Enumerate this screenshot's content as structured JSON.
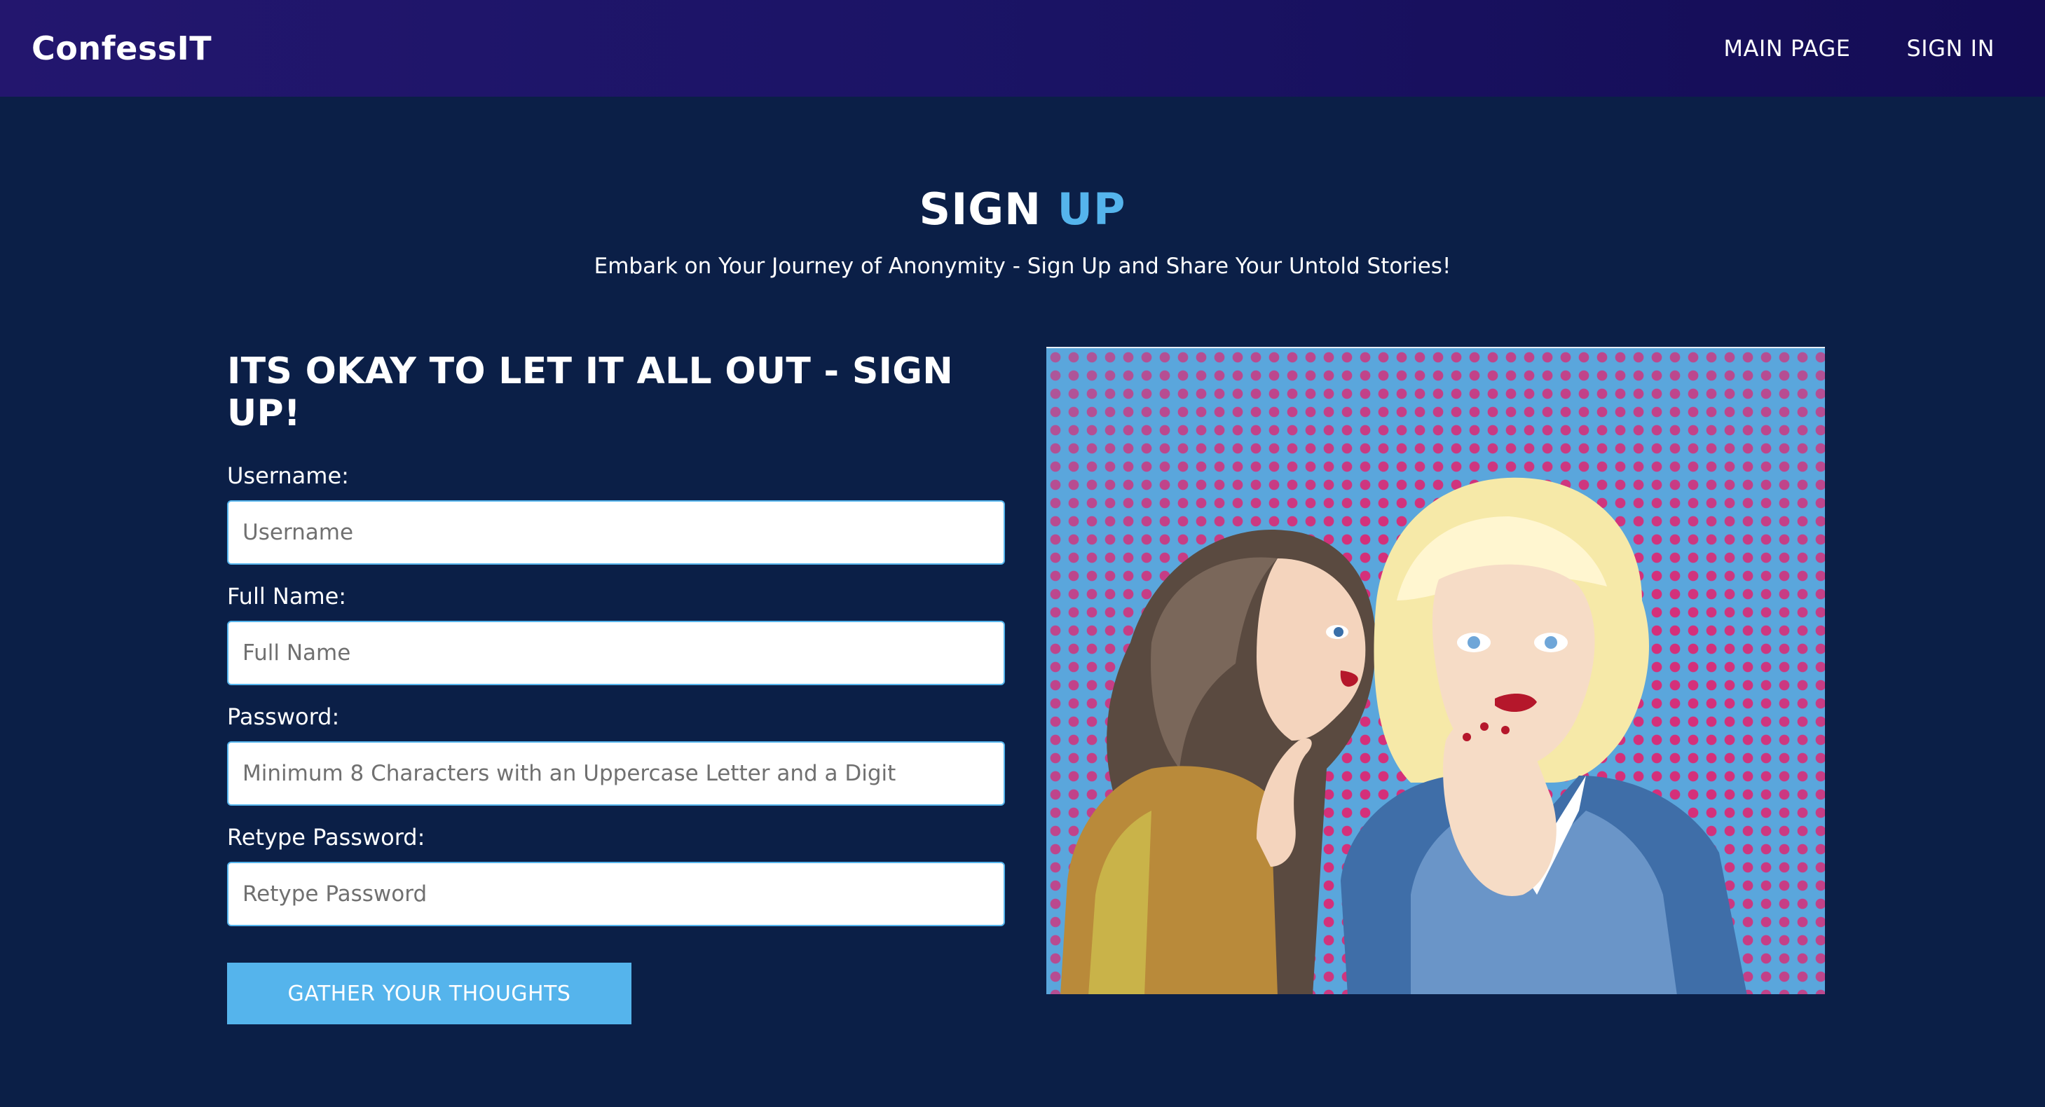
{
  "nav": {
    "brand": "ConfessIT",
    "links": [
      "MAIN PAGE",
      "SIGN IN"
    ]
  },
  "hero": {
    "title_main": "SIGN",
    "title_accent": "UP",
    "subtitle": "Embark on Your Journey of Anonymity - Sign Up and Share Your Untold Stories!"
  },
  "form": {
    "heading": "ITS OKAY TO LET IT ALL OUT - SIGN UP!",
    "fields": [
      {
        "label": "Username:",
        "placeholder": "Username",
        "value": ""
      },
      {
        "label": "Full Name:",
        "placeholder": "Full Name",
        "value": ""
      },
      {
        "label": "Password:",
        "placeholder": "Minimum 8 Characters with an Uppercase Letter and a Digit",
        "value": ""
      },
      {
        "label": "Retype Password:",
        "placeholder": "Retype Password",
        "value": ""
      }
    ],
    "submit_label": "GATHER YOUR THOUGHTS"
  },
  "colors": {
    "background": "#0b1f47",
    "navbar": "#1b1466",
    "accent": "#55b4ec",
    "halftone_dot": "#d4307a"
  },
  "illustration": {
    "description_icon": "pop-art-whispering-women-image"
  }
}
